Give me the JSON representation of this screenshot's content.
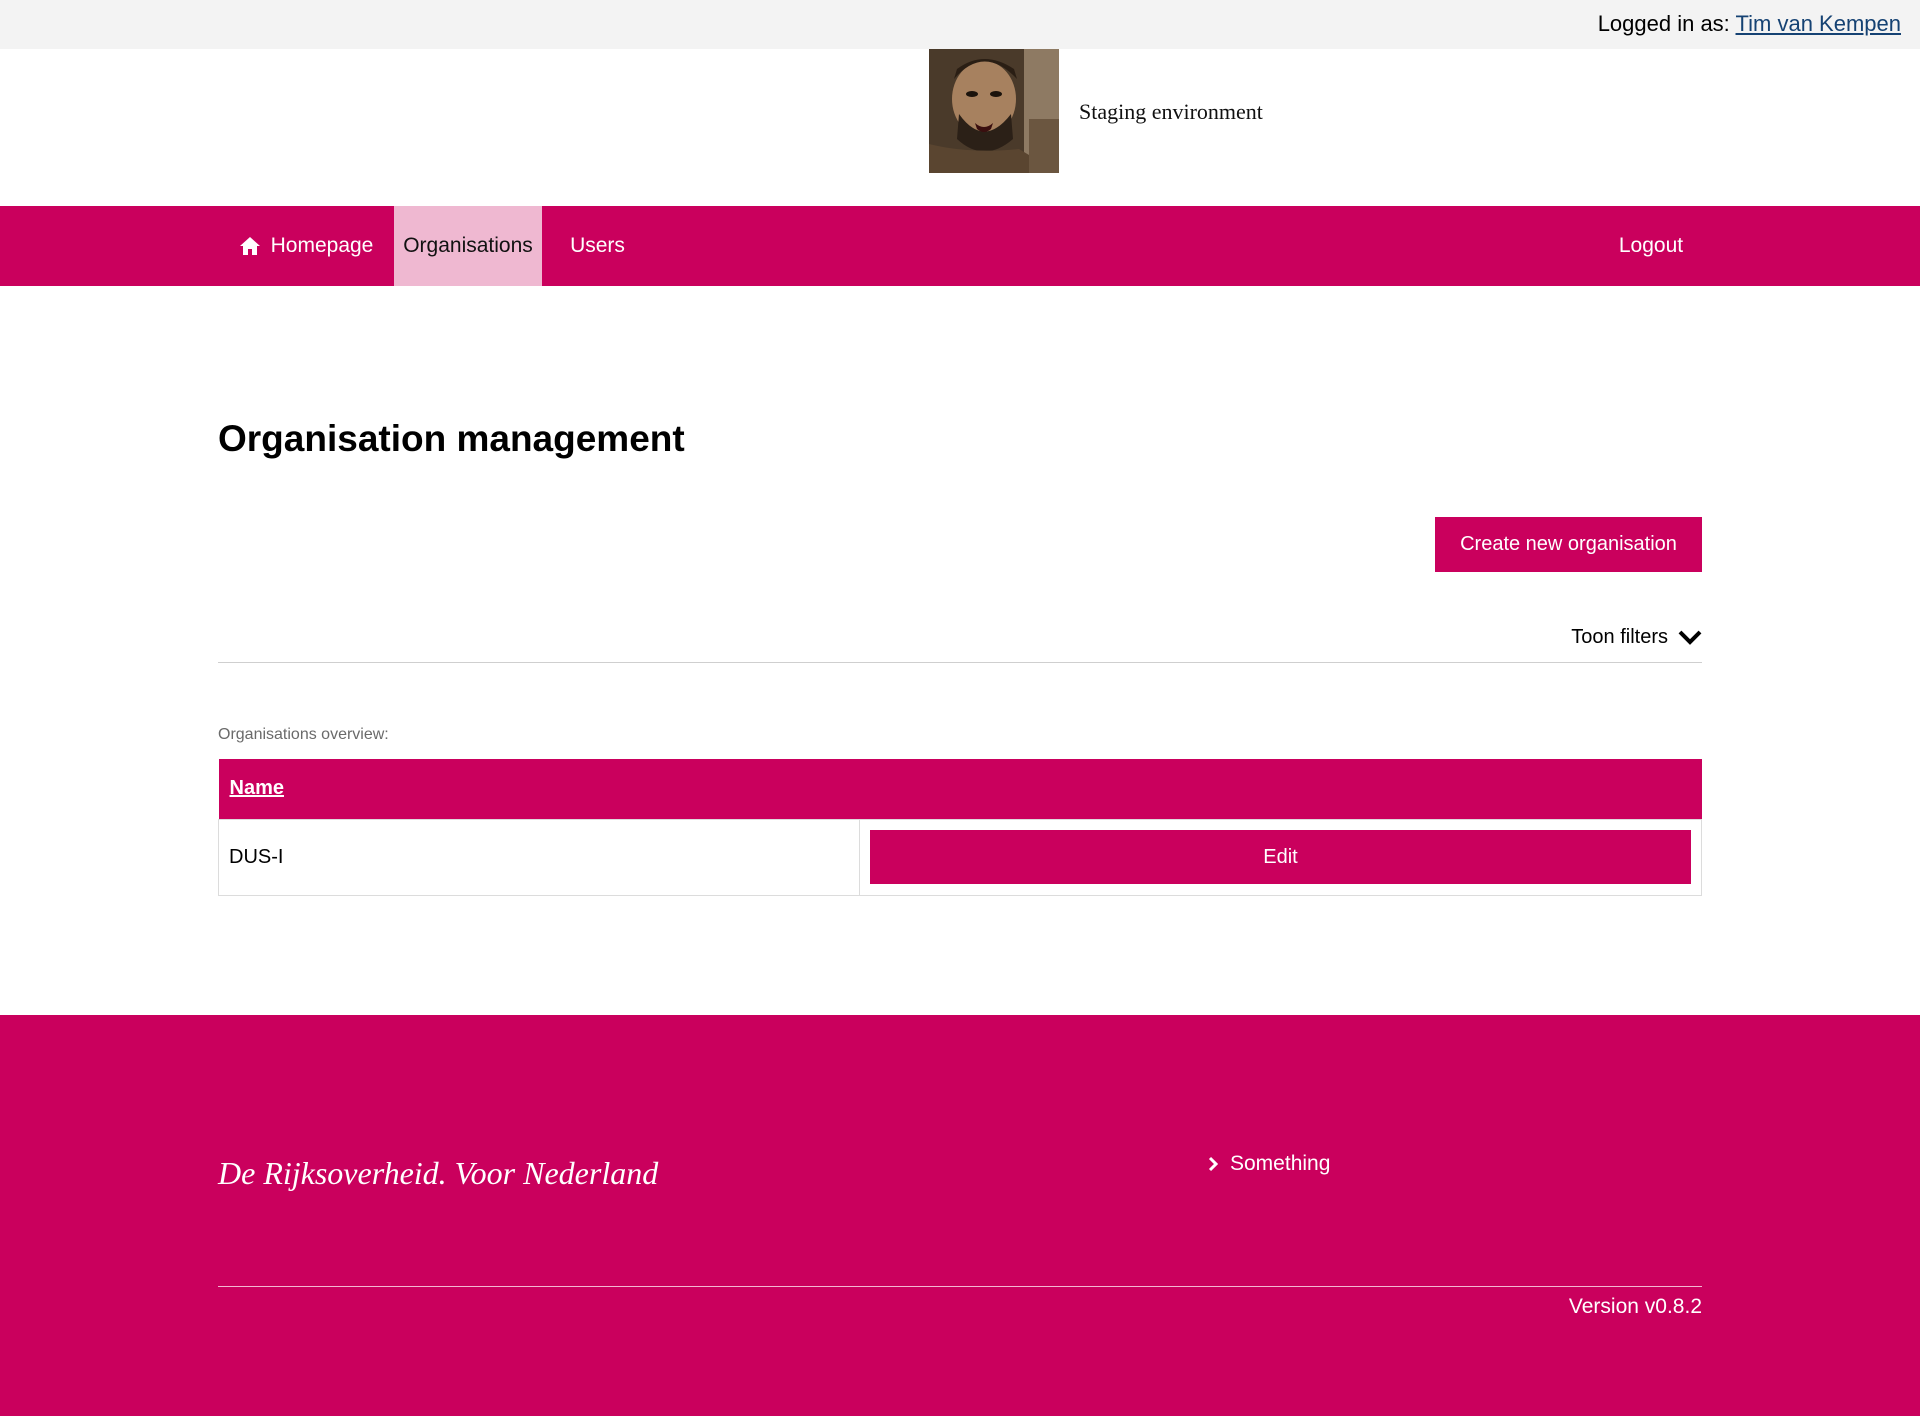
{
  "topbar": {
    "login_prefix": "Logged in as:",
    "user_name": "Tim van Kempen"
  },
  "header": {
    "environment": "Staging environment"
  },
  "nav": {
    "items": [
      {
        "label": "Homepage",
        "icon": "home-icon"
      },
      {
        "label": "Organisations",
        "active": true
      },
      {
        "label": "Users"
      }
    ],
    "logout": "Logout"
  },
  "main": {
    "title": "Organisation management",
    "create_button": "Create new organisation",
    "filters_label": "Toon filters",
    "overview_label": "Organisations overview:",
    "table": {
      "columns": [
        "Name"
      ],
      "rows": [
        {
          "name": "DUS-I",
          "action": "Edit"
        }
      ]
    }
  },
  "footer": {
    "tagline": "De Rijksoverheid. Voor Nederland",
    "link": "Something",
    "version": "Version v0.8.2"
  },
  "colors": {
    "brand": "#ca005d",
    "nav_active": "#efb8d1",
    "topbar": "#f3f3f3",
    "link": "#154273"
  }
}
